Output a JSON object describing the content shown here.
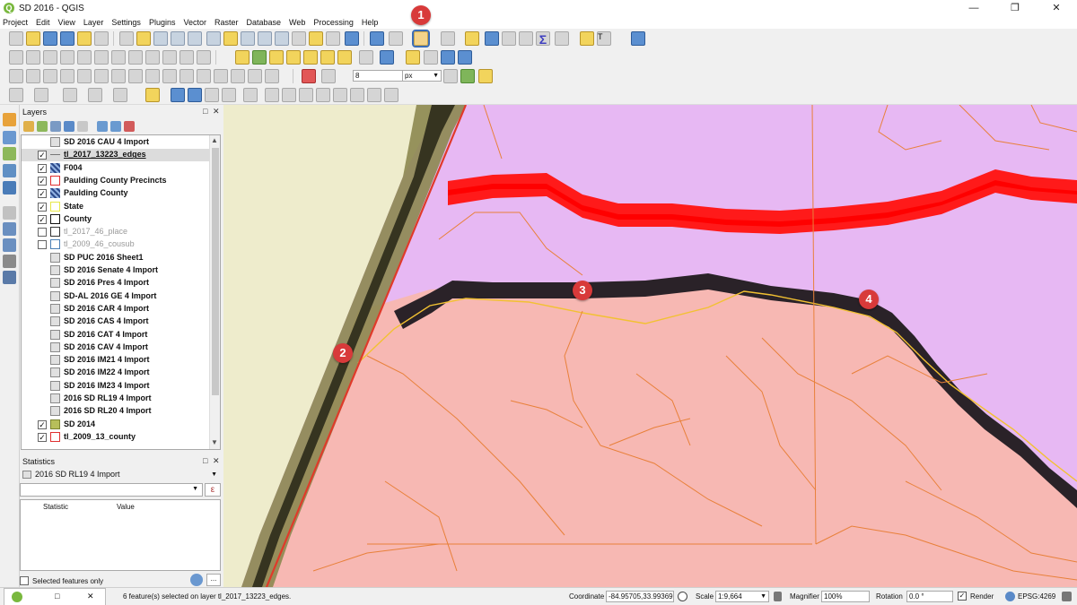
{
  "window": {
    "title": "SD 2016 - QGIS",
    "logo_letter": "Q"
  },
  "menu": [
    "Project",
    "Edit",
    "View",
    "Layer",
    "Settings",
    "Plugins",
    "Vector",
    "Raster",
    "Database",
    "Web",
    "Processing",
    "Help"
  ],
  "toolbar": {
    "snap_tolerance_value": "8",
    "snap_unit_value": "px",
    "annotation_text_label": "T"
  },
  "layers_panel": {
    "title": "Layers",
    "items": [
      {
        "label": "SD 2016 CAU 4 Import",
        "checked": null,
        "symbol": "table",
        "style": "bold"
      },
      {
        "label": "tl_2017_13223_edges",
        "checked": true,
        "symbol": "line",
        "style": "underline",
        "selected": true
      },
      {
        "label": "F004",
        "checked": true,
        "symbol": "raster",
        "style": "bold"
      },
      {
        "label": "Paulding County Precincts",
        "checked": true,
        "symbol": "poly",
        "color": "#e03030",
        "style": "bold"
      },
      {
        "label": "Paulding County",
        "checked": true,
        "symbol": "raster",
        "style": "bold"
      },
      {
        "label": "State",
        "checked": true,
        "symbol": "poly",
        "color": "#e8e84a",
        "style": "bold"
      },
      {
        "label": "County",
        "checked": true,
        "symbol": "poly",
        "color": "#111111",
        "style": "bold"
      },
      {
        "label": "tl_2017_46_place",
        "checked": false,
        "symbol": "poly",
        "color": "#333333",
        "style": "dim"
      },
      {
        "label": "tl_2009_46_cousub",
        "checked": false,
        "symbol": "poly",
        "color": "#4a7fb5",
        "style": "dim"
      },
      {
        "label": "SD PUC 2016 Sheet1",
        "checked": null,
        "symbol": "table",
        "style": "bold"
      },
      {
        "label": "SD 2016 Senate 4 Import",
        "checked": null,
        "symbol": "table",
        "style": "bold"
      },
      {
        "label": "SD 2016 Pres 4 Import",
        "checked": null,
        "symbol": "table",
        "style": "bold"
      },
      {
        "label": "SD-AL 2016 GE 4 Import",
        "checked": null,
        "symbol": "table",
        "style": "bold"
      },
      {
        "label": "SD 2016 CAR 4 Import",
        "checked": null,
        "symbol": "table",
        "style": "bold"
      },
      {
        "label": "SD 2016 CAS 4 Import",
        "checked": null,
        "symbol": "table",
        "style": "bold"
      },
      {
        "label": "SD 2016 CAT 4 Import",
        "checked": null,
        "symbol": "table",
        "style": "bold"
      },
      {
        "label": "SD 2016 CAV 4 Import",
        "checked": null,
        "symbol": "table",
        "style": "bold"
      },
      {
        "label": "SD 2016 IM21 4 Import",
        "checked": null,
        "symbol": "table",
        "style": "bold"
      },
      {
        "label": "SD 2016 IM22 4 Import",
        "checked": null,
        "symbol": "table",
        "style": "bold"
      },
      {
        "label": "SD 2016 IM23 4 Import",
        "checked": null,
        "symbol": "table",
        "style": "bold"
      },
      {
        "label": "2016 SD RL19 4 Import",
        "checked": null,
        "symbol": "table",
        "style": "bold"
      },
      {
        "label": "2016 SD RL20 4 Import",
        "checked": null,
        "symbol": "table",
        "style": "bold"
      },
      {
        "label": "SD 2014",
        "checked": true,
        "symbol": "poly",
        "fill": "#b7bf5a",
        "color": "#7c8430",
        "style": "bold"
      },
      {
        "label": "tl_2009_13_county",
        "checked": true,
        "symbol": "poly",
        "color": "#e03030",
        "style": "bold"
      }
    ]
  },
  "statistics_panel": {
    "title": "Statistics",
    "layer": "2016 SD RL19 4 Import",
    "col_statistic": "Statistic",
    "col_value": "Value",
    "selected_only_label": "Selected features only",
    "more_label": "..."
  },
  "map_markers": [
    {
      "label": "1"
    },
    {
      "label": "2"
    },
    {
      "label": "3"
    },
    {
      "label": "4"
    }
  ],
  "colors": {
    "purple_fill": "#e7b8f3",
    "pink_fill": "#f7b8b3",
    "state_beige": "#eeeccc",
    "red_band": "#ff1010",
    "accent_marker": "#d83a3a"
  },
  "statusbar": {
    "message": "6 feature(s) selected on layer tl_2017_13223_edges.",
    "coordinate_label": "Coordinate",
    "coordinate_value": "-84.95705,33.99369",
    "scale_label": "Scale",
    "scale_value": "1:9,664",
    "magnifier_label": "Magnifier",
    "magnifier_value": "100%",
    "rotation_label": "Rotation",
    "rotation_value": "0.0 °",
    "render_label": "Render",
    "crs_label": "EPSG:4269"
  }
}
